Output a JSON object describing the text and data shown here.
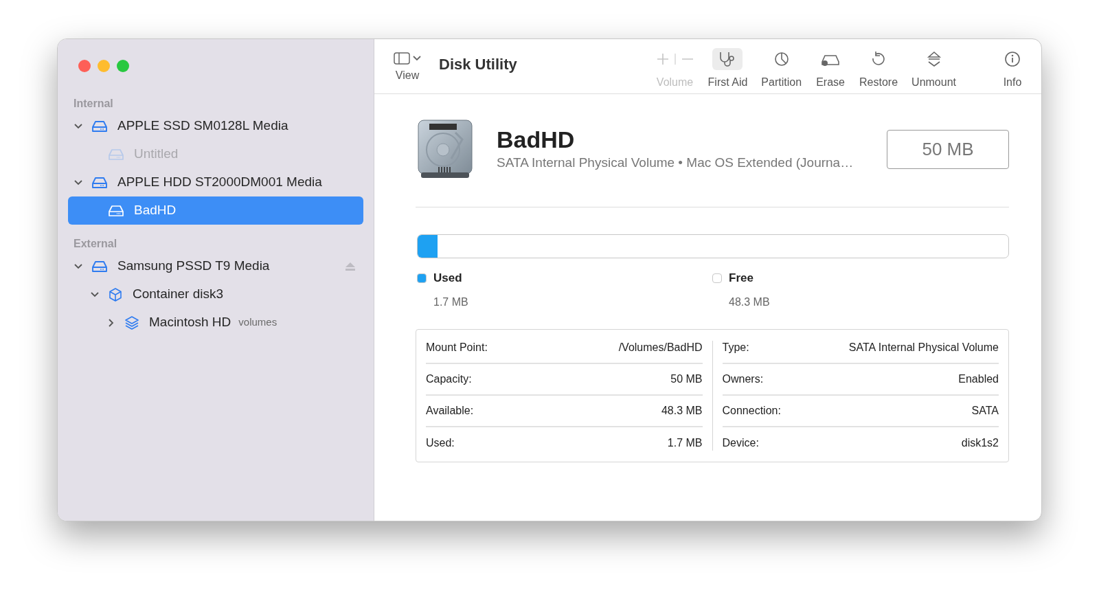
{
  "window": {
    "title": "Disk Utility"
  },
  "toolbar": {
    "view": {
      "label": "View"
    },
    "buttons": [
      {
        "kind": "volume",
        "label": "Volume",
        "disabled": true,
        "selected": false
      },
      {
        "kind": "firstaid",
        "label": "First Aid",
        "disabled": false,
        "selected": true
      },
      {
        "kind": "partition",
        "label": "Partition",
        "disabled": false,
        "selected": false
      },
      {
        "kind": "erase",
        "label": "Erase",
        "disabled": false,
        "selected": false
      },
      {
        "kind": "restore",
        "label": "Restore",
        "disabled": false,
        "selected": false
      },
      {
        "kind": "unmount",
        "label": "Unmount",
        "disabled": false,
        "selected": false
      },
      {
        "kind": "info",
        "label": "Info",
        "disabled": false,
        "selected": false
      }
    ]
  },
  "sidebar": {
    "sections": [
      {
        "title": "Internal",
        "items": [
          {
            "kind": "drive",
            "label": "APPLE SSD SM0128L Media",
            "expanded": true,
            "selected": false,
            "children": [
              {
                "kind": "volume",
                "label": "Untitled",
                "disabled": true,
                "selected": false
              }
            ]
          },
          {
            "kind": "drive",
            "label": "APPLE HDD ST2000DM001 Media",
            "expanded": true,
            "selected": false,
            "children": [
              {
                "kind": "volume",
                "label": "BadHD",
                "disabled": false,
                "selected": true
              }
            ]
          }
        ]
      },
      {
        "title": "External",
        "items": [
          {
            "kind": "drive",
            "label": "Samsung PSSD T9 Media",
            "expanded": true,
            "selected": false,
            "ejectable": true,
            "children": [
              {
                "kind": "container",
                "label": "Container disk3",
                "expanded": true,
                "selected": false,
                "children": [
                  {
                    "kind": "stack",
                    "label": "Macintosh HD",
                    "badge": "volumes",
                    "expanded": false,
                    "selected": false
                  }
                ]
              }
            ]
          }
        ]
      }
    ]
  },
  "volume": {
    "name": "BadHD",
    "subtitle": "SATA Internal Physical Volume • Mac OS Extended (Journa…",
    "size": "50 MB",
    "usage": {
      "level": 0.034,
      "legend": [
        {
          "label": "Used",
          "value": "1.7 MB",
          "color": "#1ea1f2"
        },
        {
          "label": "Free",
          "value": "48.3 MB",
          "color": "#ffffff"
        }
      ]
    },
    "info_left": [
      {
        "label": "Mount Point:",
        "value": "/Volumes/BadHD"
      },
      {
        "label": "Capacity:",
        "value": "50 MB"
      },
      {
        "label": "Available:",
        "value": "48.3 MB"
      },
      {
        "label": "Used:",
        "value": "1.7 MB"
      }
    ],
    "info_right": [
      {
        "label": "Type:",
        "value": "SATA Internal Physical Volume"
      },
      {
        "label": "Owners:",
        "value": "Enabled"
      },
      {
        "label": "Connection:",
        "value": "SATA"
      },
      {
        "label": "Device:",
        "value": "disk1s2"
      }
    ]
  }
}
